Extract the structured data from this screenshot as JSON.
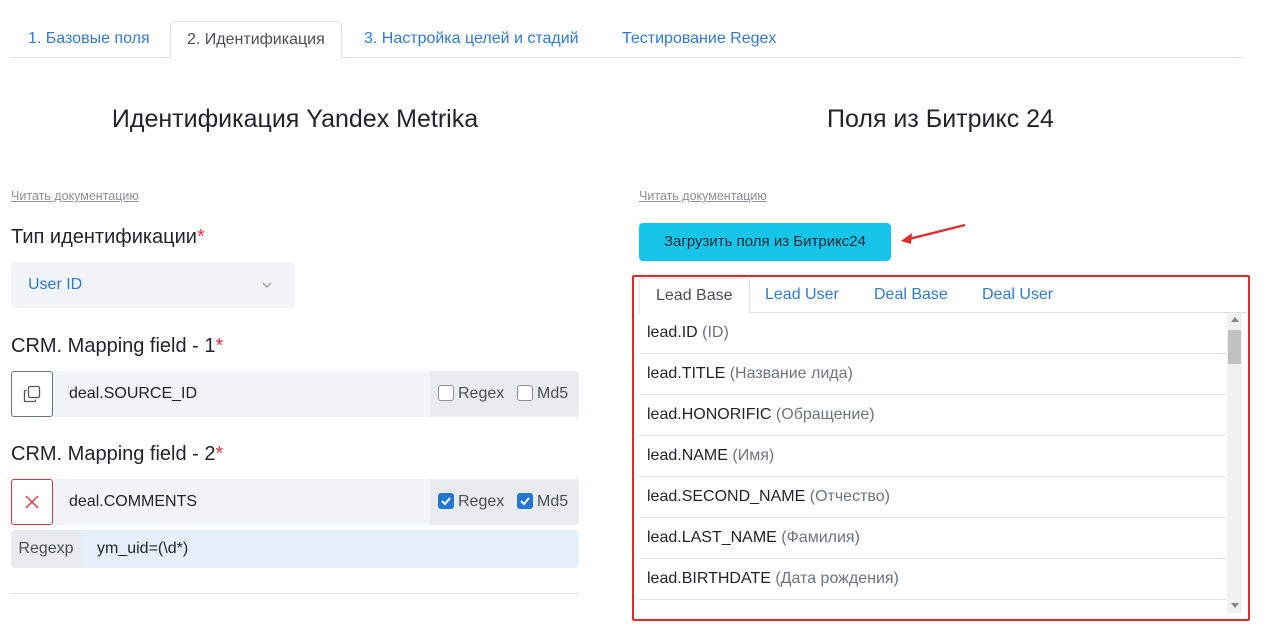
{
  "tabs": [
    {
      "label": "1. Базовые поля"
    },
    {
      "label": "2. Идентификация"
    },
    {
      "label": "3. Настройка целей и стадий"
    },
    {
      "label": "Тестирование Regex"
    }
  ],
  "left": {
    "title": "Идентификация Yandex Metrika",
    "doc_link": "Читать документацию",
    "id_type_label": "Тип идентификации",
    "required_mark": "*",
    "id_type_value": "User ID",
    "mapping1": {
      "label": "CRM. Mapping field - 1",
      "field": "deal.SOURCE_ID",
      "regex_label": "Regex",
      "md5_label": "Md5",
      "regex_checked": false,
      "md5_checked": false
    },
    "mapping2": {
      "label": "CRM. Mapping field - 2",
      "field": "deal.COMMENTS",
      "regex_label": "Regex",
      "md5_label": "Md5",
      "regex_checked": true,
      "md5_checked": true,
      "regexp_tag": "Regexp",
      "regexp_value": "ym_uid=(\\d*)"
    }
  },
  "right": {
    "title": "Поля из Битрикс 24",
    "doc_link": "Читать документацию",
    "load_button": "Загрузить поля из Битрикс24",
    "inner_tabs": [
      {
        "label": "Lead Base"
      },
      {
        "label": "Lead User"
      },
      {
        "label": "Deal Base"
      },
      {
        "label": "Deal User"
      }
    ],
    "fields": [
      {
        "code": "lead.ID",
        "name": "(ID)"
      },
      {
        "code": "lead.TITLE",
        "name": "(Название лида)"
      },
      {
        "code": "lead.HONORIFIC",
        "name": "(Обращение)"
      },
      {
        "code": "lead.NAME",
        "name": "(Имя)"
      },
      {
        "code": "lead.SECOND_NAME",
        "name": "(Отчество)"
      },
      {
        "code": "lead.LAST_NAME",
        "name": "(Фамилия)"
      },
      {
        "code": "lead.BIRTHDATE",
        "name": "(Дата рождения)"
      }
    ]
  },
  "colors": {
    "accent": "#2f7bd3",
    "button": "#17c5ea",
    "highlight": "#e02b2b",
    "required": "#dc3545"
  }
}
